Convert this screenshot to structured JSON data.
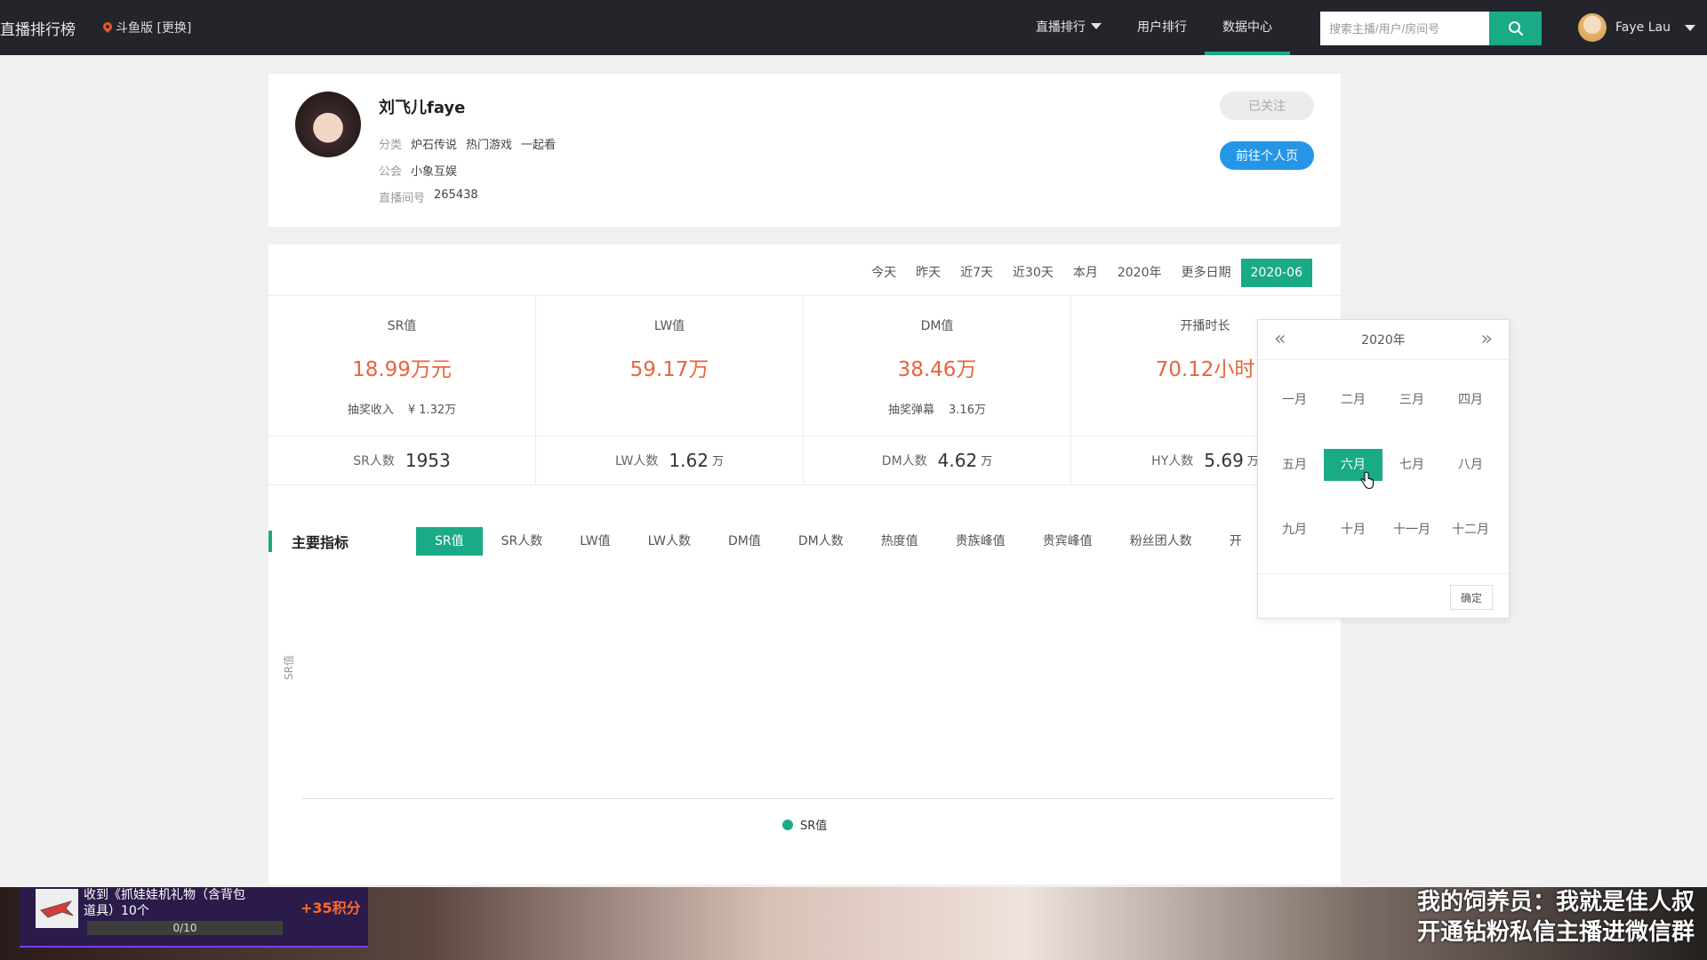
{
  "nav": {
    "brand": "直播排行榜",
    "location": "斗鱼版 [更换]",
    "links": [
      {
        "label": "直播排行",
        "dropdown": true
      },
      {
        "label": "用户排行"
      },
      {
        "label": "数据中心",
        "active": true
      }
    ],
    "search_placeholder": "搜索主播/用户/房间号",
    "user_name": "Faye Lau",
    "accent": "#1aaa86"
  },
  "profile": {
    "name": "刘飞儿faye",
    "category_label": "分类",
    "categories": [
      "炉石传说",
      "热门游戏",
      "一起看"
    ],
    "guild_label": "公会",
    "guild": "小象互娱",
    "room_label": "直播间号",
    "room": "265438",
    "follow_label": "已关注",
    "goto_label": "前往个人页"
  },
  "date_tabs": [
    "今天",
    "昨天",
    "近7天",
    "近30天",
    "本月",
    "2020年",
    "更多日期",
    "2020-06"
  ],
  "metrics": [
    {
      "label": "SR值",
      "value": "18.99万元",
      "sub_label": "抽奖收入",
      "sub_value": "¥ 1.32万"
    },
    {
      "label": "LW值",
      "value": "59.17万",
      "sub_label": "",
      "sub_value": ""
    },
    {
      "label": "DM值",
      "value": "38.46万",
      "sub_label": "抽奖弹幕",
      "sub_value": "3.16万"
    },
    {
      "label": "开播时长",
      "value": "70.12小时",
      "sub_label": "",
      "sub_value": ""
    }
  ],
  "counts": [
    {
      "label": "SR人数",
      "value": "1953",
      "unit": ""
    },
    {
      "label": "LW人数",
      "value": "1.62",
      "unit": "万"
    },
    {
      "label": "DM人数",
      "value": "4.62",
      "unit": "万"
    },
    {
      "label": "HY人数",
      "value": "5.69",
      "unit": "万"
    }
  ],
  "indicators": {
    "title": "主要指标",
    "tabs": [
      "SR值",
      "SR人数",
      "LW值",
      "LW人数",
      "DM值",
      "DM人数",
      "热度值",
      "贵族峰值",
      "贵宾峰值",
      "粉丝团人数",
      "开"
    ]
  },
  "chart": {
    "ylabel": "SR值",
    "legend": "SR值"
  },
  "picker": {
    "year": "2020年",
    "months": [
      "一月",
      "二月",
      "三月",
      "四月",
      "五月",
      "六月",
      "七月",
      "八月",
      "九月",
      "十月",
      "十一月",
      "十二月"
    ],
    "selected_index": 5,
    "confirm": "确定"
  },
  "overlay": {
    "task_text": "收到《抓娃娃机礼物（含背包道具）10个",
    "task_progress": "0/10",
    "task_points": "+35积分",
    "marquee_line1": "我的饲养员：我就是佳人叔",
    "marquee_line2": "开通钻粉私信主播进微信群"
  }
}
